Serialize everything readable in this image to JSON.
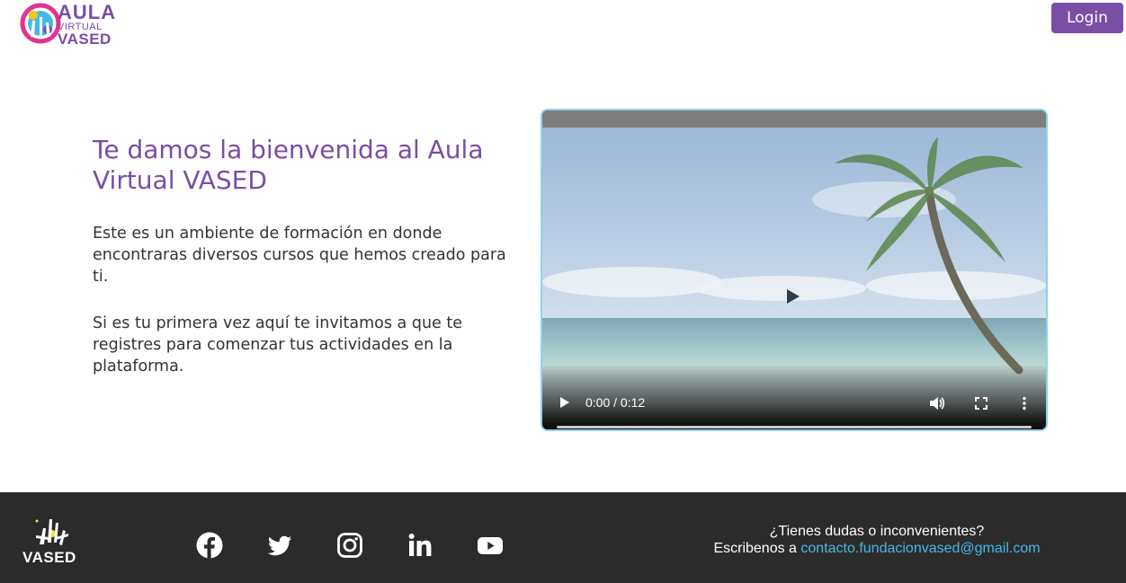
{
  "header": {
    "logo": {
      "line1": "AULA",
      "line2": "VIRTUAL",
      "line3": "VASED"
    },
    "login_label": "Login"
  },
  "main": {
    "title": "Te damos la bienvenida al Aula Virtual VASED",
    "paragraph1": "Este es un ambiente de formación en donde encontraras diversos cursos que hemos creado para ti.",
    "paragraph2": "Si es tu primera vez aquí te invitamos a que te registres para comenzar tus actividades en la plataforma."
  },
  "video": {
    "time": "0:00 / 0:12",
    "progress": 0,
    "icons": [
      "play-icon",
      "volume-icon",
      "fullscreen-icon",
      "more-icon"
    ]
  },
  "footer": {
    "logo_text": "VASED",
    "social": [
      "facebook-icon",
      "twitter-icon",
      "instagram-icon",
      "linkedin-icon",
      "youtube-icon"
    ],
    "contact_question": "¿Tienes dudas o inconvenientes?",
    "contact_prefix": "Escribenos a",
    "contact_email": "contacto.fundacionvased@gmail.com"
  },
  "colors": {
    "brand_purple": "#7a4ea5",
    "footer_bg": "#2b2b2b",
    "link_blue": "#44b7e8",
    "video_border": "#8fd3ea"
  }
}
